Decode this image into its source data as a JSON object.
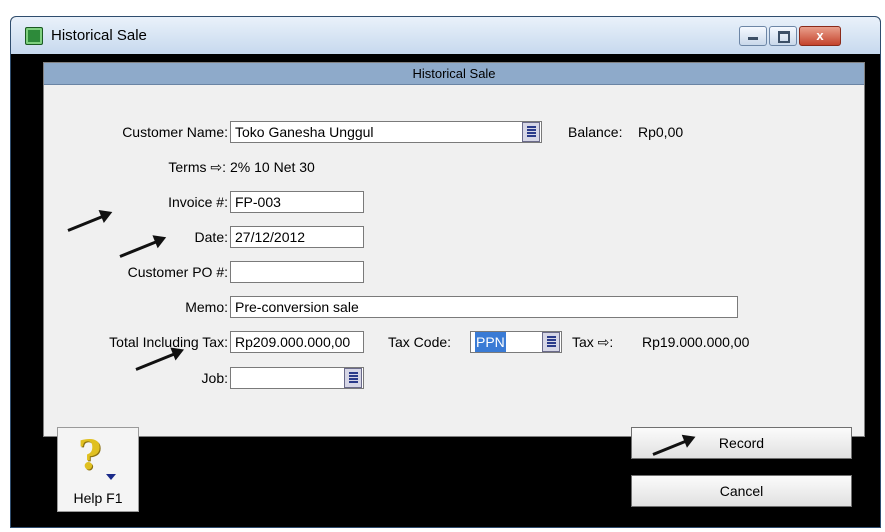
{
  "window": {
    "title": "Historical Sale",
    "header": "Historical Sale",
    "icons": {
      "app": "app-icon",
      "minimize": "minimize-icon",
      "maximize": "maximize-icon",
      "close": "close-icon"
    },
    "close_glyph": "x"
  },
  "form": {
    "customer_name_label": "Customer Name:",
    "customer_name": "Toko Ganesha Unggul",
    "balance_label": "Balance:",
    "balance": "Rp0,00",
    "terms_label": "Terms ⇨:",
    "terms": "2% 10 Net 30",
    "invoice_label": "Invoice #:",
    "invoice": "FP-003",
    "date_label": "Date:",
    "date": "27/12/2012",
    "customer_po_label": "Customer PO #:",
    "customer_po": "",
    "memo_label": "Memo:",
    "memo": "Pre-conversion sale",
    "total_label": "Total Including Tax:",
    "total": "Rp209.000.000,00",
    "tax_code_label": "Tax Code:",
    "tax_code": "PPN",
    "tax_label": "Tax ⇨:",
    "tax": "Rp19.000.000,00",
    "job_label": "Job:",
    "job": ""
  },
  "buttons": {
    "help": "Help F1",
    "record": "Record",
    "cancel": "Cancel"
  }
}
